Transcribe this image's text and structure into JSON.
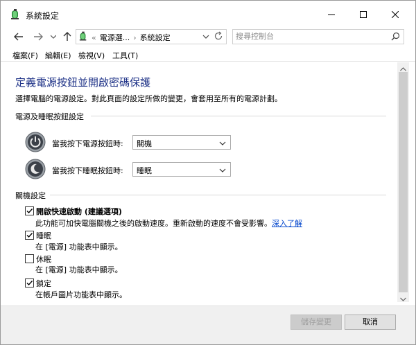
{
  "window": {
    "title": "系統設定",
    "colors": {
      "accent": "#1e3287",
      "link": "#0044cc"
    }
  },
  "address": {
    "crumb_prefix": "«",
    "crumb1": "電源選...",
    "crumb_sep": "›",
    "crumb2": "系統設定",
    "search_placeholder": "搜尋控制台"
  },
  "menu": {
    "file": "檔案(F)",
    "edit": "編輯(E)",
    "view": "檢視(V)",
    "tools": "工具(T)"
  },
  "page": {
    "title": "定義電源按鈕並開啟密碼保護",
    "description": "選擇電腦的電源設定。對此頁面的設定所做的變更，會套用至所有的電源計劃。"
  },
  "buttons_section": {
    "header": "電源及睡眠按鈕設定",
    "power_label": "當我按下電源按鈕時:",
    "power_value": "關機",
    "sleep_label": "當我按下睡眠按鈕時:",
    "sleep_value": "睡眠"
  },
  "shutdown_section": {
    "header": "關機設定",
    "items": [
      {
        "label": "開啟快速啟動 (建議選項)",
        "checked": true,
        "desc": "此功能可加快電腦關機之後的啟動速度。重新啟動的速度不會受影響。",
        "link": "深入了解"
      },
      {
        "label": "睡眠",
        "checked": true,
        "desc": "在 [電源] 功能表中顯示。"
      },
      {
        "label": "休眠",
        "checked": false,
        "desc": "在 [電源] 功能表中顯示。"
      },
      {
        "label": "鎖定",
        "checked": true,
        "desc": "在帳戶圖片功能表中顯示。"
      }
    ]
  },
  "footer": {
    "save": "儲存變更",
    "cancel": "取消"
  },
  "icons": [
    "control-panel-icon",
    "minimize-icon",
    "maximize-icon",
    "close-icon",
    "back-arrow-icon",
    "forward-arrow-icon",
    "up-arrow-icon",
    "chevron-down-icon",
    "refresh-icon",
    "search-icon",
    "power-button-icon",
    "sleep-button-icon",
    "checkmark-icon"
  ]
}
